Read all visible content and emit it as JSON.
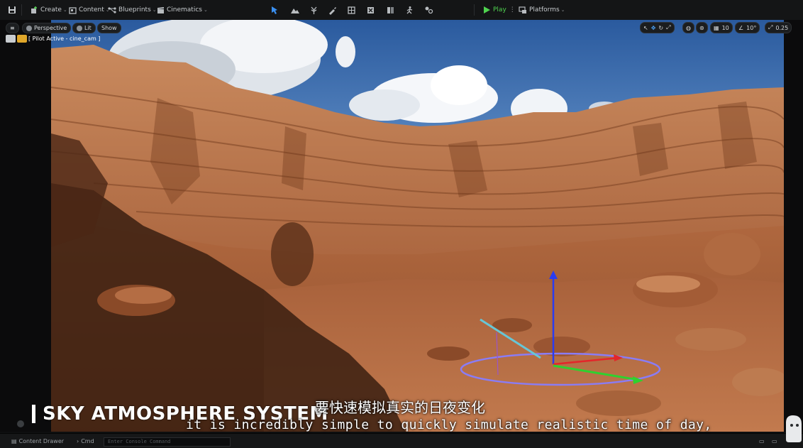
{
  "toolbar": {
    "create_label": "Create",
    "content_label": "Content",
    "blueprints_label": "Blueprints",
    "cinematics_label": "Cinematics",
    "play_label": "Play",
    "platforms_label": "Platforms",
    "play_color": "#4fd34f"
  },
  "viewport": {
    "perspective_label": "Perspective",
    "lit_label": "Lit",
    "show_label": "Show",
    "pilot_label": "[ Pilot Active - cine_cam ]",
    "grid_snap_value": "10",
    "rotation_snap_value": "10°",
    "scale_snap_value": "0.25"
  },
  "overlay": {
    "title": "SKY ATMOSPHERE SYSTEM",
    "subtitle_cn": "要快速模拟真实的日夜变化",
    "subtitle_en": "it is incredibly simple to quickly simulate realistic time of day,"
  },
  "statusbar": {
    "content_drawer_label": "Content Drawer",
    "cmd_label": "Cmd",
    "console_placeholder": "Enter Console Command"
  },
  "colors": {
    "gizmo_x": "#e3262a",
    "gizmo_y": "#2fd12f",
    "gizmo_z": "#2a3cf0",
    "gizmo_ring": "#8a7cf4",
    "light_arrow": "#67c6d6"
  }
}
